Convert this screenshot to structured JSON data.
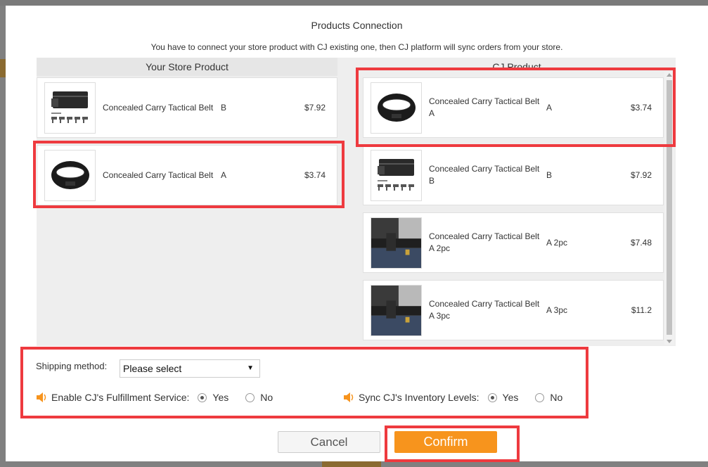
{
  "modal": {
    "title": "Products Connection",
    "subtitle": "You have to connect your store product with CJ existing one, then CJ platform will sync orders from your store."
  },
  "left_column": {
    "header": "Your Store Product",
    "products": [
      {
        "name": "Concealed Carry Tactical Belt",
        "variant": "B",
        "price": "$7.92",
        "image": "belt-with-guns-image"
      },
      {
        "name": "Concealed Carry Tactical Belt",
        "variant": "A",
        "price": "$3.74",
        "image": "black-belt-image"
      }
    ]
  },
  "right_column": {
    "header": "CJ Product",
    "products": [
      {
        "name": "Concealed Carry Tactical Belt A",
        "variant": "A",
        "price": "$3.74",
        "image": "black-belt-image"
      },
      {
        "name": "Concealed Carry Tactical Belt B",
        "variant": "B",
        "price": "$7.92",
        "image": "belt-with-guns-image"
      },
      {
        "name": "Concealed Carry Tactical Belt A 2pc",
        "variant": "A 2pc",
        "price": "$7.48",
        "image": "worn-holster-image"
      },
      {
        "name": "Concealed Carry Tactical Belt A 3pc",
        "variant": "A 3pc",
        "price": "$11.2",
        "image": "worn-holster-image"
      }
    ]
  },
  "shipping": {
    "label": "Shipping method:",
    "selected": "Please select"
  },
  "options": {
    "fulfillment": {
      "label": "Enable CJ's Fulfillment Service:",
      "yes": "Yes",
      "no": "No",
      "value": "Yes"
    },
    "inventory": {
      "label": "Sync CJ's Inventory Levels:",
      "yes": "Yes",
      "no": "No",
      "value": "Yes"
    }
  },
  "buttons": {
    "cancel": "Cancel",
    "confirm": "Confirm"
  },
  "colors": {
    "accent": "#f7941d",
    "highlight": "#ee3a3f",
    "panel_bg": "#eeeeee"
  }
}
